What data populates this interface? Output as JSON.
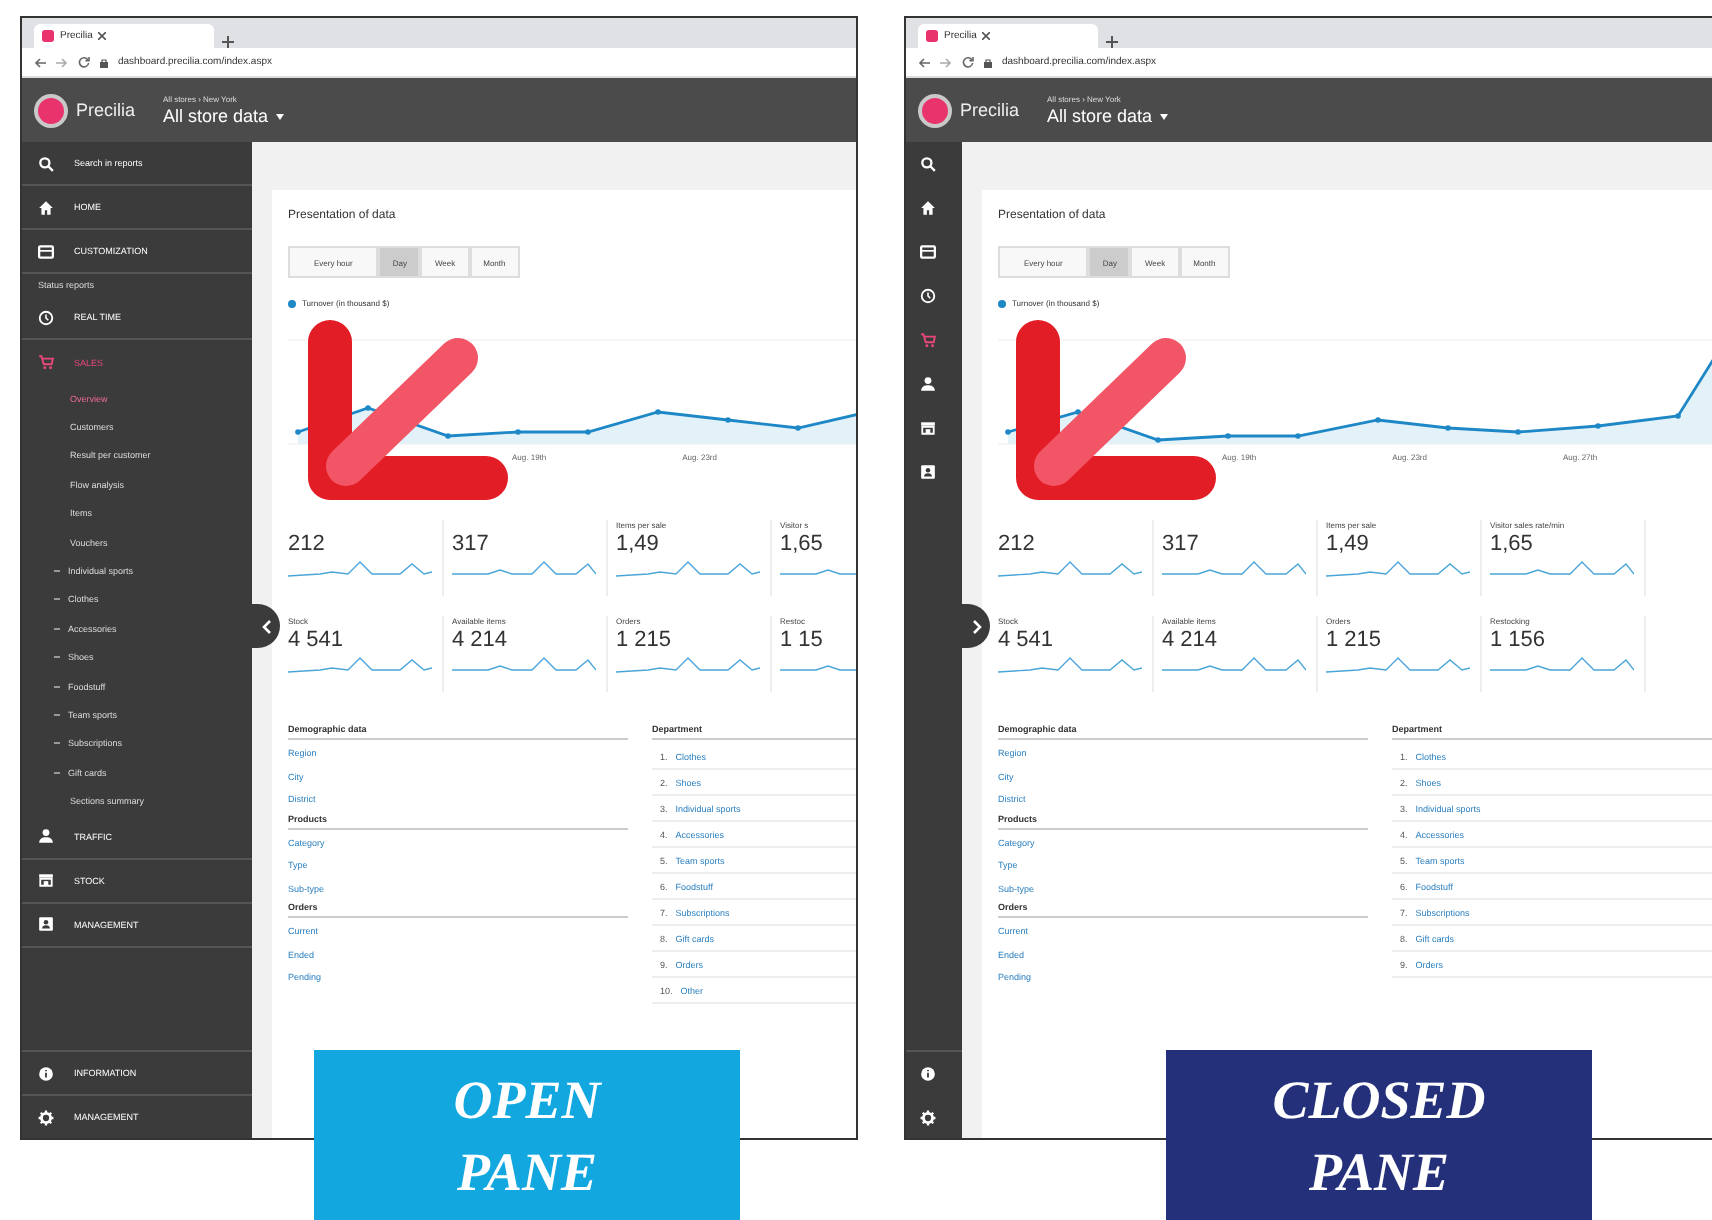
{
  "screens": [
    {
      "pane_open": true,
      "caption": {
        "text": "OPEN\nPANE",
        "color": "#13a7e0"
      },
      "browser": {
        "tab_title": "Precilia",
        "url": "dashboard.precilia.com/index.aspx"
      },
      "header": {
        "brand": "Precilia",
        "breadcrumb": "All stores › New York",
        "store_selector": "All store data"
      },
      "sidebar": {
        "items": [
          {
            "kind": "search",
            "label": "Search in reports",
            "selected": false
          },
          {
            "kind": "home",
            "label": "HOME",
            "selected": false
          },
          {
            "kind": "customization",
            "label": "CUSTOMIZATION",
            "selected": false
          },
          {
            "kind": "heading",
            "label": "Status reports"
          },
          {
            "kind": "realtime",
            "label": "REAL TIME",
            "selected": false
          },
          {
            "kind": "sales",
            "label": "SALES",
            "selected": true,
            "children": [
              {
                "kind": "page",
                "label": "Overview",
                "selected": true
              },
              {
                "kind": "page",
                "label": "Customers",
                "selected": false
              },
              {
                "kind": "page",
                "label": "Result per customer",
                "selected": false
              },
              {
                "kind": "page",
                "label": "Flow analysis",
                "selected": false
              },
              {
                "kind": "page",
                "label": "Items",
                "selected": false
              },
              {
                "kind": "page",
                "label": "Vouchers",
                "selected": false
              },
              {
                "kind": "category",
                "label": "Individual sports",
                "selected": false
              },
              {
                "kind": "category",
                "label": "Clothes",
                "selected": false
              },
              {
                "kind": "category",
                "label": "Accessories",
                "selected": false
              },
              {
                "kind": "category",
                "label": "Shoes",
                "selected": false
              },
              {
                "kind": "category",
                "label": "Foodstuff",
                "selected": false
              },
              {
                "kind": "category",
                "label": "Team sports",
                "selected": false
              },
              {
                "kind": "category",
                "label": "Subscriptions",
                "selected": false
              },
              {
                "kind": "category",
                "label": "Gift cards",
                "selected": false
              },
              {
                "kind": "page",
                "label": "Sections summary",
                "selected": false
              }
            ]
          },
          {
            "kind": "traffic",
            "label": "TRAFFIC",
            "selected": false
          },
          {
            "kind": "stock",
            "label": "STOCK",
            "selected": false
          },
          {
            "kind": "management",
            "label": "MANAGEMENT",
            "selected": false
          }
        ],
        "bottom_items": [
          {
            "kind": "information",
            "label": "INFORMATION",
            "selected": false
          },
          {
            "kind": "settings",
            "label": "MANAGEMENT",
            "selected": false
          }
        ]
      },
      "content": {
        "title": "Presentation of data",
        "periods": [
          {
            "label": "Every hour",
            "selected": false
          },
          {
            "label": "Day",
            "selected": true
          },
          {
            "label": "Week",
            "selected": false
          },
          {
            "label": "Month",
            "selected": false
          }
        ],
        "legend": "Turnover (in thousand $)",
        "x_labels": [
          "Aug. 19th",
          "Aug. 23rd"
        ],
        "kpis": [
          {
            "value": "212"
          },
          {
            "value": "317"
          },
          {
            "label": "Items per sale",
            "value": "1,49"
          },
          {
            "label": "Visitor s",
            "value": "1,65"
          },
          {
            "label": "Stock",
            "value": "4 541"
          },
          {
            "label": "Available items",
            "value": "4 214"
          },
          {
            "label": "Orders",
            "value": "1 215"
          },
          {
            "label": "Restoc",
            "value": "1 15"
          }
        ],
        "groups": [
          {
            "title": "Demographic data",
            "links": [
              "Region",
              "City",
              "District"
            ]
          },
          {
            "title": "Products",
            "links": [
              "Category",
              "Type",
              "Sub-type"
            ]
          },
          {
            "title": "Orders",
            "links": [
              "Current",
              "Ended",
              "Pending"
            ]
          }
        ],
        "department": {
          "title": "Department",
          "items": [
            {
              "rank": "1.",
              "label": "Clothes"
            },
            {
              "rank": "2.",
              "label": "Shoes"
            },
            {
              "rank": "3.",
              "label": "Individual sports"
            },
            {
              "rank": "4.",
              "label": "Accessories"
            },
            {
              "rank": "5.",
              "label": "Team sports"
            },
            {
              "rank": "6.",
              "label": "Foodstuff"
            },
            {
              "rank": "7.",
              "label": "Subscriptions"
            },
            {
              "rank": "8.",
              "label": "Gift cards"
            },
            {
              "rank": "9.",
              "label": "Orders"
            },
            {
              "rank": "10.",
              "label": "Other"
            }
          ]
        }
      }
    },
    {
      "pane_open": false,
      "caption": {
        "text": "CLOSED\nPANE",
        "color": "#25307a"
      },
      "browser": {
        "tab_title": "Precilia",
        "url": "dashboard.precilia.com/index.aspx"
      },
      "header": {
        "brand": "Precilia",
        "breadcrumb": "All stores › New York",
        "store_selector": "All store data"
      },
      "sidebar": {
        "items": [
          {
            "kind": "search",
            "selected": false
          },
          {
            "kind": "home",
            "selected": false
          },
          {
            "kind": "customization",
            "selected": false
          },
          {
            "kind": "realtime",
            "selected": false
          },
          {
            "kind": "sales",
            "selected": true
          },
          {
            "kind": "traffic",
            "selected": false
          },
          {
            "kind": "stock",
            "selected": false
          },
          {
            "kind": "management",
            "selected": false
          }
        ],
        "bottom_items": [
          {
            "kind": "information",
            "selected": false
          },
          {
            "kind": "settings",
            "selected": false
          }
        ]
      },
      "content": {
        "title": "Presentation of data",
        "periods": [
          {
            "label": "Every hour",
            "selected": false
          },
          {
            "label": "Day",
            "selected": true
          },
          {
            "label": "Week",
            "selected": false
          },
          {
            "label": "Month",
            "selected": false
          }
        ],
        "legend": "Turnover (in thousand $)",
        "x_labels": [
          "Aug. 19th",
          "Aug. 23rd",
          "Aug. 27th"
        ],
        "kpis": [
          {
            "value": "212"
          },
          {
            "value": "317"
          },
          {
            "label": "Items per sale",
            "value": "1,49"
          },
          {
            "label": "Visitor sales rate/min",
            "value": "1,65"
          },
          {
            "label": "Stock",
            "value": "4 541"
          },
          {
            "label": "Available items",
            "value": "4 214"
          },
          {
            "label": "Orders",
            "value": "1 215"
          },
          {
            "label": "Restocking",
            "value": "1 156"
          }
        ],
        "groups": [
          {
            "title": "Demographic data",
            "links": [
              "Region",
              "City",
              "District"
            ]
          },
          {
            "title": "Products",
            "links": [
              "Category",
              "Type",
              "Sub-type"
            ]
          },
          {
            "title": "Orders",
            "links": [
              "Current",
              "Ended",
              "Pending"
            ]
          }
        ],
        "department": {
          "title": "Department",
          "items": [
            {
              "rank": "1.",
              "label": "Clothes"
            },
            {
              "rank": "2.",
              "label": "Shoes"
            },
            {
              "rank": "3.",
              "label": "Individual sports"
            },
            {
              "rank": "4.",
              "label": "Accessories"
            },
            {
              "rank": "5.",
              "label": "Team sports"
            },
            {
              "rank": "6.",
              "label": "Foodstuff"
            },
            {
              "rank": "7.",
              "label": "Subscriptions"
            },
            {
              "rank": "8.",
              "label": "Gift cards"
            },
            {
              "rank": "9.",
              "label": "Orders"
            }
          ]
        }
      }
    }
  ]
}
